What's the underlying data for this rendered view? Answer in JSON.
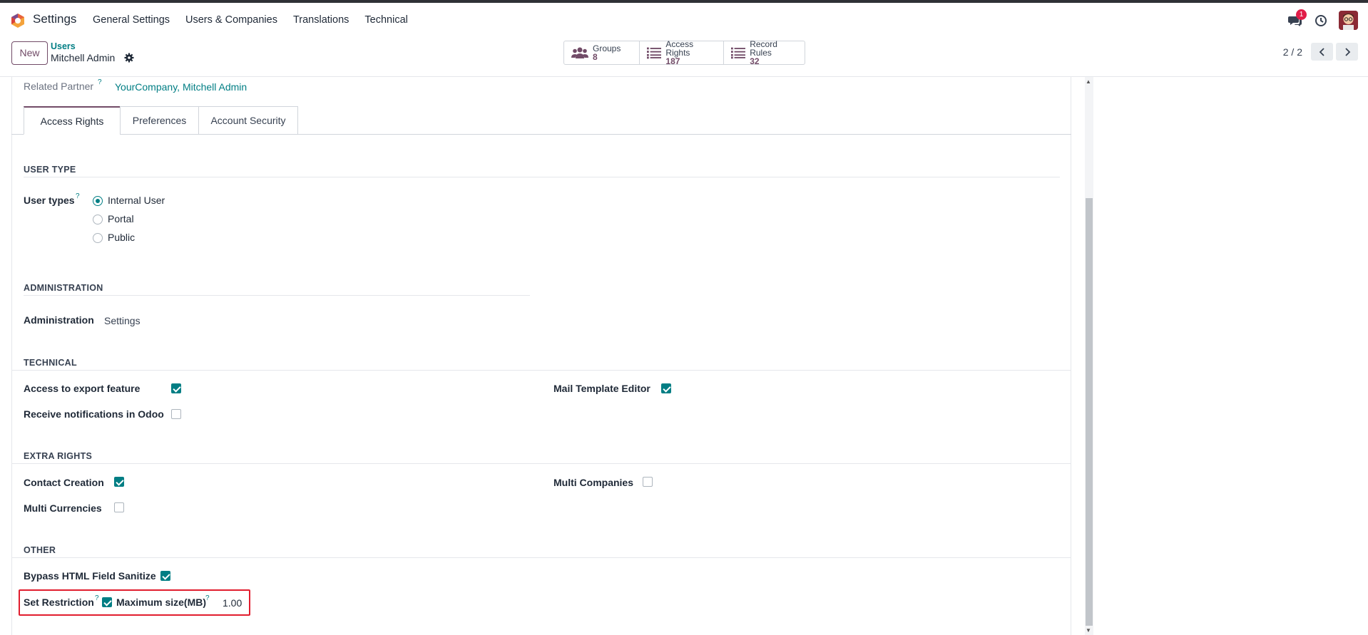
{
  "navbar": {
    "app_name": "Settings",
    "menu": [
      "General Settings",
      "Users & Companies",
      "Translations",
      "Technical"
    ],
    "chat_badge": "1",
    "icons": [
      "odoo-logo-icon",
      "chat-icon",
      "clock-icon",
      "avatar"
    ]
  },
  "control": {
    "new_label": "New",
    "breadcrumb_parent": "Users",
    "record_title": "Mitchell Admin",
    "smart_buttons": [
      {
        "label": "Groups",
        "value": "8",
        "icon": "groups-icon"
      },
      {
        "label": "Access Rights",
        "value": "187",
        "icon": "list-icon"
      },
      {
        "label": "Record Rules",
        "value": "32",
        "icon": "list-icon"
      }
    ],
    "pager": "2 / 2"
  },
  "form": {
    "related_partner_label": "Related Partner",
    "help_mark": "?",
    "related_partner_value": "YourCompany, Mitchell Admin",
    "tabs": [
      "Access Rights",
      "Preferences",
      "Account Security"
    ],
    "user_type": {
      "section": "USER TYPE",
      "label": "User types",
      "options": [
        "Internal User",
        "Portal",
        "Public"
      ],
      "selected": "Internal User"
    },
    "administration": {
      "section": "ADMINISTRATION",
      "label": "Administration",
      "value": "Settings"
    },
    "technical": {
      "section": "TECHNICAL",
      "export_label": "Access to export feature",
      "export_checked": true,
      "notif_label": "Receive notifications in Odoo",
      "notif_checked": false,
      "mail_label": "Mail Template Editor",
      "mail_checked": true
    },
    "extra_rights": {
      "section": "EXTRA RIGHTS",
      "contact_label": "Contact Creation",
      "contact_checked": true,
      "currency_label": "Multi Currencies",
      "currency_checked": false,
      "companies_label": "Multi Companies",
      "companies_checked": false
    },
    "other": {
      "section": "OTHER",
      "bypass_label": "Bypass HTML Field Sanitize",
      "bypass_checked": true,
      "restriction_label": "Set Restriction",
      "restriction_checked": true,
      "max_size_label": "Maximum size(MB)",
      "max_size_value": "1.00"
    }
  },
  "colors": {
    "accent": "#714b67",
    "teal": "#017e84",
    "highlight_box": "#e11d2e"
  }
}
